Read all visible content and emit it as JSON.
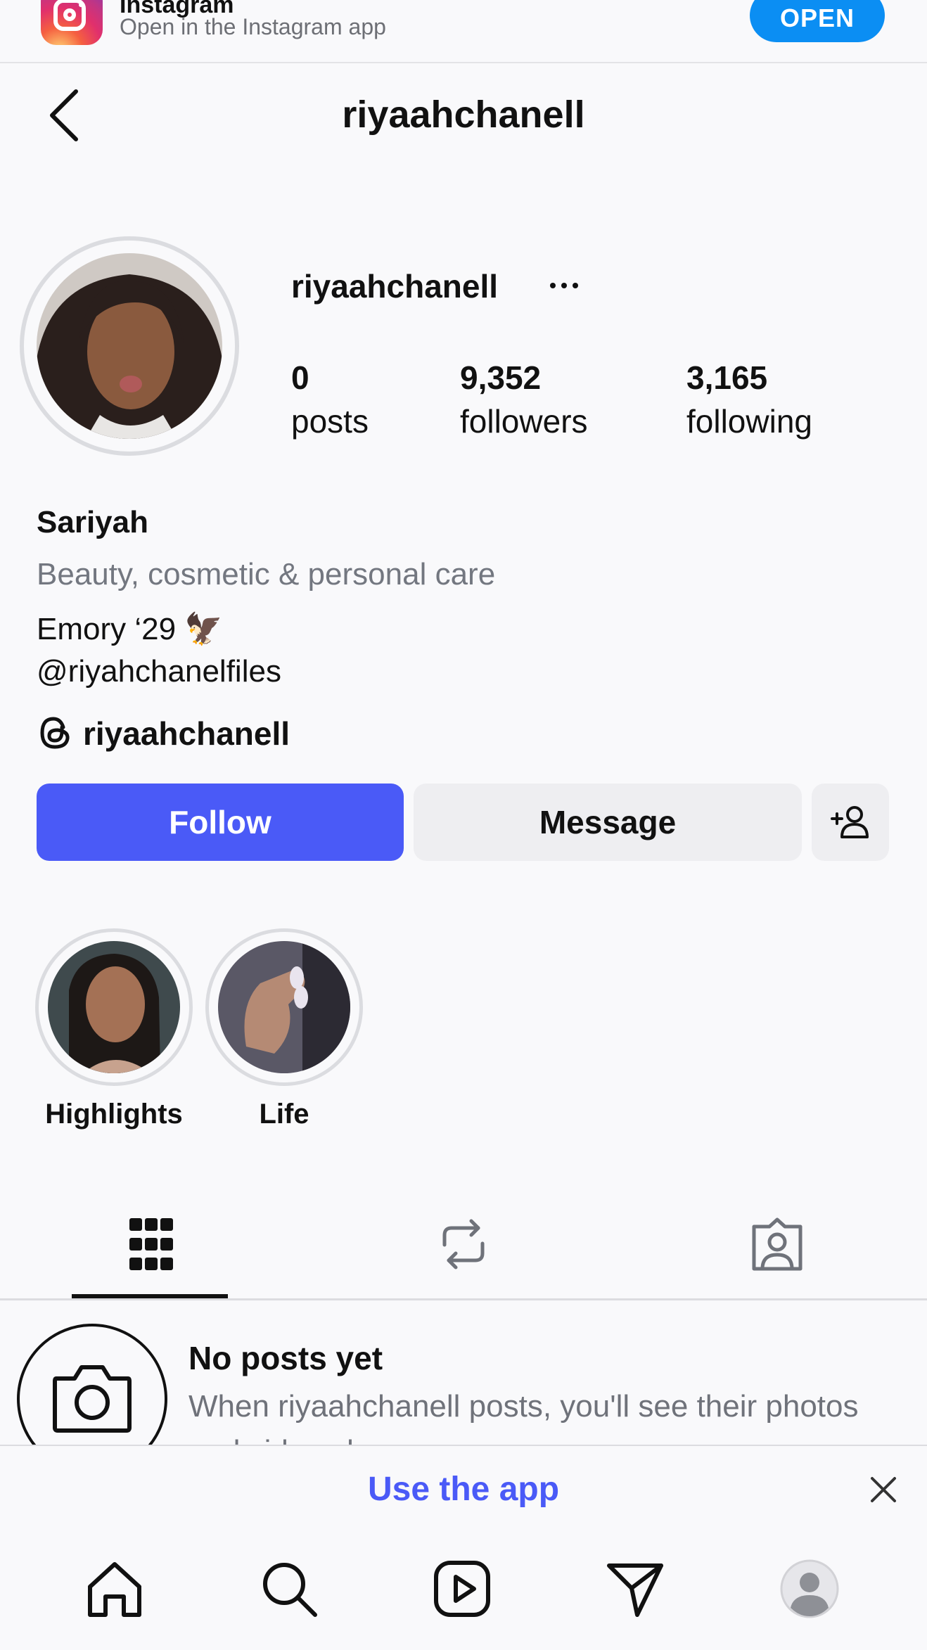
{
  "banner": {
    "title": "Instagram",
    "subtitle": "Open in the Instagram app",
    "open_label": "OPEN"
  },
  "header": {
    "title": "riyaahchanell"
  },
  "profile": {
    "username": "riyaahchanell",
    "stats": [
      {
        "value": "0",
        "label": "posts"
      },
      {
        "value": "9,352",
        "label": "followers"
      },
      {
        "value": "3,165",
        "label": "following"
      }
    ],
    "name": "Sariyah",
    "category": "Beauty, cosmetic & personal care",
    "bio_line1": "Emory ‘29 🦅",
    "bio_line2": "@riyahchanelfiles",
    "threads_handle": "riyaahchanell"
  },
  "actions": {
    "follow_label": "Follow",
    "message_label": "Message"
  },
  "highlights": [
    {
      "label": "Highlights"
    },
    {
      "label": "Life"
    }
  ],
  "empty_state": {
    "title": "No posts yet",
    "subtitle": "When riyaahchanell posts, you'll see their photos and videos here."
  },
  "use_app": {
    "label": "Use the app"
  },
  "colors": {
    "follow_button": "#4a5af7",
    "open_button": "#0b8ef3",
    "secondary_text": "#737780",
    "background": "#f9f9fb"
  }
}
